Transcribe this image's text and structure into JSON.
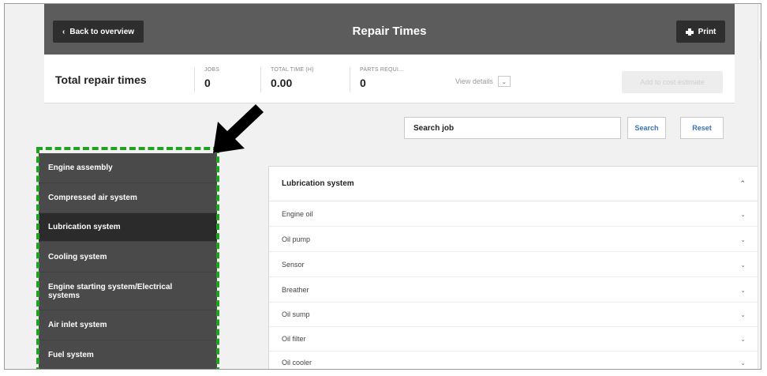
{
  "header": {
    "back_label": "Back to overview",
    "title": "Repair Times",
    "print_label": "Print"
  },
  "totals": {
    "title": "Total repair times",
    "jobs_label": "JOBS",
    "jobs_value": "0",
    "time_label": "TOTAL TIME (H)",
    "time_value": "0.00",
    "parts_label": "PARTS REQUI...",
    "parts_value": "0",
    "view_details": "View details",
    "add_estimate": "Add to cost estimate"
  },
  "search": {
    "input_value": "Search job",
    "search_label": "Search",
    "reset_label": "Reset"
  },
  "sidebar": {
    "items": [
      {
        "label": "Engine assembly",
        "active": false
      },
      {
        "label": "Compressed air system",
        "active": false
      },
      {
        "label": "Lubrication system",
        "active": true
      },
      {
        "label": "Cooling system",
        "active": false
      },
      {
        "label": "Engine starting system/Electrical systems",
        "active": false
      },
      {
        "label": "Air inlet system",
        "active": false
      },
      {
        "label": "Fuel system",
        "active": false
      }
    ]
  },
  "panel": {
    "title": "Lubrication system",
    "rows": [
      {
        "label": "Engine oil"
      },
      {
        "label": "Oil pump"
      },
      {
        "label": "Sensor"
      },
      {
        "label": "Breather"
      },
      {
        "label": "Oil sump"
      },
      {
        "label": "Oil filter"
      },
      {
        "label": "Oil cooler"
      }
    ]
  },
  "colors": {
    "highlight": "#21a121",
    "topbar": "#5c5c5c",
    "sidebar": "#4a4a4a",
    "sidebar_active": "#2b2b2b",
    "link": "#3a73b6"
  },
  "icons": {
    "back": "chevron-left-icon",
    "print": "printer-icon",
    "expand": "chevron-down-icon",
    "collapse": "chevron-up-icon",
    "pointer": "arrow-pointer-icon"
  }
}
